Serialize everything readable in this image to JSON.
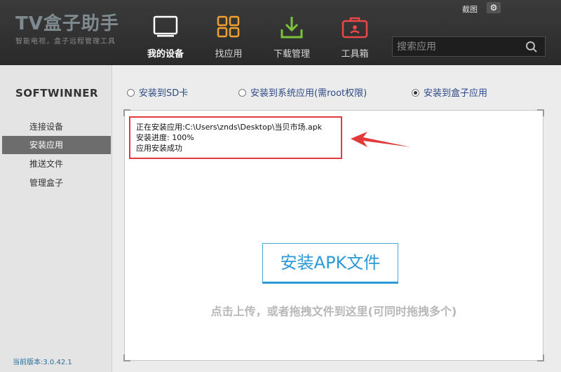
{
  "header": {
    "logo_title": "TV盒子助手",
    "logo_subtitle": "智能电视，盒子远程管理工具",
    "nav": [
      {
        "label": "我的设备",
        "icon": "monitor-icon",
        "active": true
      },
      {
        "label": "找应用",
        "icon": "grid-icon",
        "active": false
      },
      {
        "label": "下载管理",
        "icon": "download-icon",
        "active": false
      },
      {
        "label": "工具箱",
        "icon": "toolbox-icon",
        "active": false
      }
    ],
    "screenshot_label": "截图",
    "settings_icon": "gear-icon",
    "search_placeholder": "搜索应用"
  },
  "sidebar": {
    "brand": "SOFTWINNER",
    "items": [
      {
        "label": "连接设备",
        "active": false
      },
      {
        "label": "安装应用",
        "active": true
      },
      {
        "label": "推送文件",
        "active": false
      },
      {
        "label": "管理盒子",
        "active": false
      }
    ],
    "version": "当前版本:3.0.42.1"
  },
  "main": {
    "install_options": [
      {
        "label": "安装到SD卡",
        "checked": false
      },
      {
        "label": "安装到系统应用(需root权限)",
        "checked": false
      },
      {
        "label": "安装到盒子应用",
        "checked": true
      }
    ],
    "log_lines": [
      "正在安装应用:C:\\Users\\znds\\Desktop\\当贝市场.apk",
      "安装进度:  100%",
      "应用安装成功"
    ],
    "install_button": "安装APK文件",
    "hint": "点击上传，或者拖拽文件到这里(可同时拖拽多个)"
  },
  "colors": {
    "accent": "#2a9ad8",
    "highlight_border": "#e23a3a",
    "topbar": "#2f2f2f"
  }
}
